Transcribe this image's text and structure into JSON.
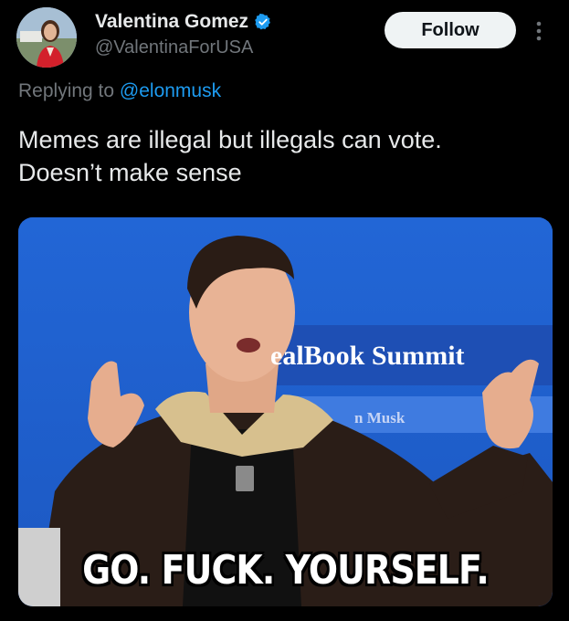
{
  "author": {
    "display_name": "Valentina Gomez",
    "handle": "@ValentinaForUSA",
    "verified": true
  },
  "actions": {
    "follow_label": "Follow"
  },
  "reply": {
    "prefix": "Replying to ",
    "target": "@elonmusk"
  },
  "tweet": {
    "lines": [
      "Memes are illegal but illegals can vote.",
      "Doesn’t make sense"
    ]
  },
  "media": {
    "sign_text": "ealBook Summit",
    "sign_subtext": "n Musk",
    "caption": "GO. FUCK. YOURSELF."
  },
  "colors": {
    "background": "#000000",
    "link": "#1d9bf0",
    "verified": "#1d9bf0",
    "secondary_text": "#71767b"
  },
  "icons": [
    "verified-badge-icon",
    "more-options-icon"
  ]
}
